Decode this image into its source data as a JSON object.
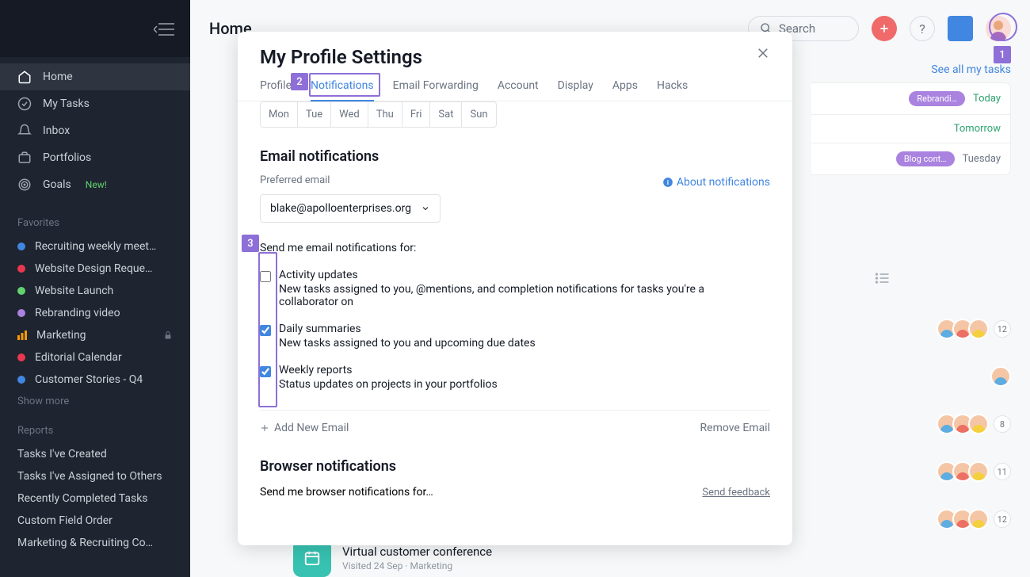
{
  "sidebar": {
    "nav": [
      {
        "label": "Home",
        "icon": "home",
        "active": true
      },
      {
        "label": "My Tasks",
        "icon": "check",
        "active": false
      },
      {
        "label": "Inbox",
        "icon": "bell",
        "active": false
      },
      {
        "label": "Portfolios",
        "icon": "briefcase",
        "active": false
      },
      {
        "label": "Goals",
        "icon": "target",
        "active": false,
        "new": "New!"
      }
    ],
    "favorites_title": "Favorites",
    "favorites": [
      {
        "label": "Recruiting weekly meet…",
        "color": "#4186e0"
      },
      {
        "label": "Website Design Reque…",
        "color": "#e8384f"
      },
      {
        "label": "Website Launch",
        "color": "#62d26f"
      },
      {
        "label": "Rebranding video",
        "color": "#aa82e0"
      },
      {
        "label": "Marketing",
        "color": "#fd9a00",
        "bars": true,
        "locked": true
      },
      {
        "label": "Editorial Calendar",
        "color": "#e8384f"
      },
      {
        "label": "Customer Stories - Q4",
        "color": "#4186e0"
      }
    ],
    "show_more": "Show more",
    "reports_title": "Reports",
    "reports": [
      "Tasks I've Created",
      "Tasks I've Assigned to Others",
      "Recently Completed Tasks",
      "Custom Field Order",
      "Marketing & Recruiting Co…"
    ]
  },
  "topbar": {
    "title": "Home",
    "search": "Search"
  },
  "tasks": {
    "see_all": "See all my tasks",
    "rows": [
      {
        "pill": "Rebrandi…",
        "date": "Today",
        "dc": "date-today"
      },
      {
        "pill": "",
        "date": "Tomorrow",
        "dc": "date-tomorrow"
      },
      {
        "pill": "Blog cont…",
        "date": "Tuesday",
        "dc": "date-tuesday"
      }
    ]
  },
  "project": {
    "name": "Virtual customer conference",
    "sub": "Visited 24 Sep · Marketing"
  },
  "project_counts": [
    "12",
    "",
    "8",
    "11",
    "12"
  ],
  "modal": {
    "title": "My Profile Settings",
    "tabs": [
      "Profile",
      "Notifications",
      "Email Forwarding",
      "Account",
      "Display",
      "Apps",
      "Hacks"
    ],
    "active_tab": 1,
    "days": [
      "Mon",
      "Tue",
      "Wed",
      "Thu",
      "Fri",
      "Sat",
      "Sun"
    ],
    "email_section": "Email notifications",
    "preferred_label": "Preferred email",
    "about": "About notifications",
    "email_value": "blake@apolloenterprises.org",
    "intro": "Send me email notifications for:",
    "checks": [
      {
        "label": "Activity updates",
        "desc": "New tasks assigned to you, @mentions, and completion notifications for tasks you're a collaborator on",
        "checked": false
      },
      {
        "label": "Daily summaries",
        "desc": "New tasks assigned to you and upcoming due dates",
        "checked": true
      },
      {
        "label": "Weekly reports",
        "desc": "Status updates on projects in your portfolios",
        "checked": true
      }
    ],
    "add_email": "Add New Email",
    "remove_email": "Remove Email",
    "browser_section": "Browser notifications",
    "browser_intro": "Send me browser notifications for…",
    "feedback": "Send feedback"
  },
  "callouts": [
    "1",
    "2",
    "3"
  ]
}
